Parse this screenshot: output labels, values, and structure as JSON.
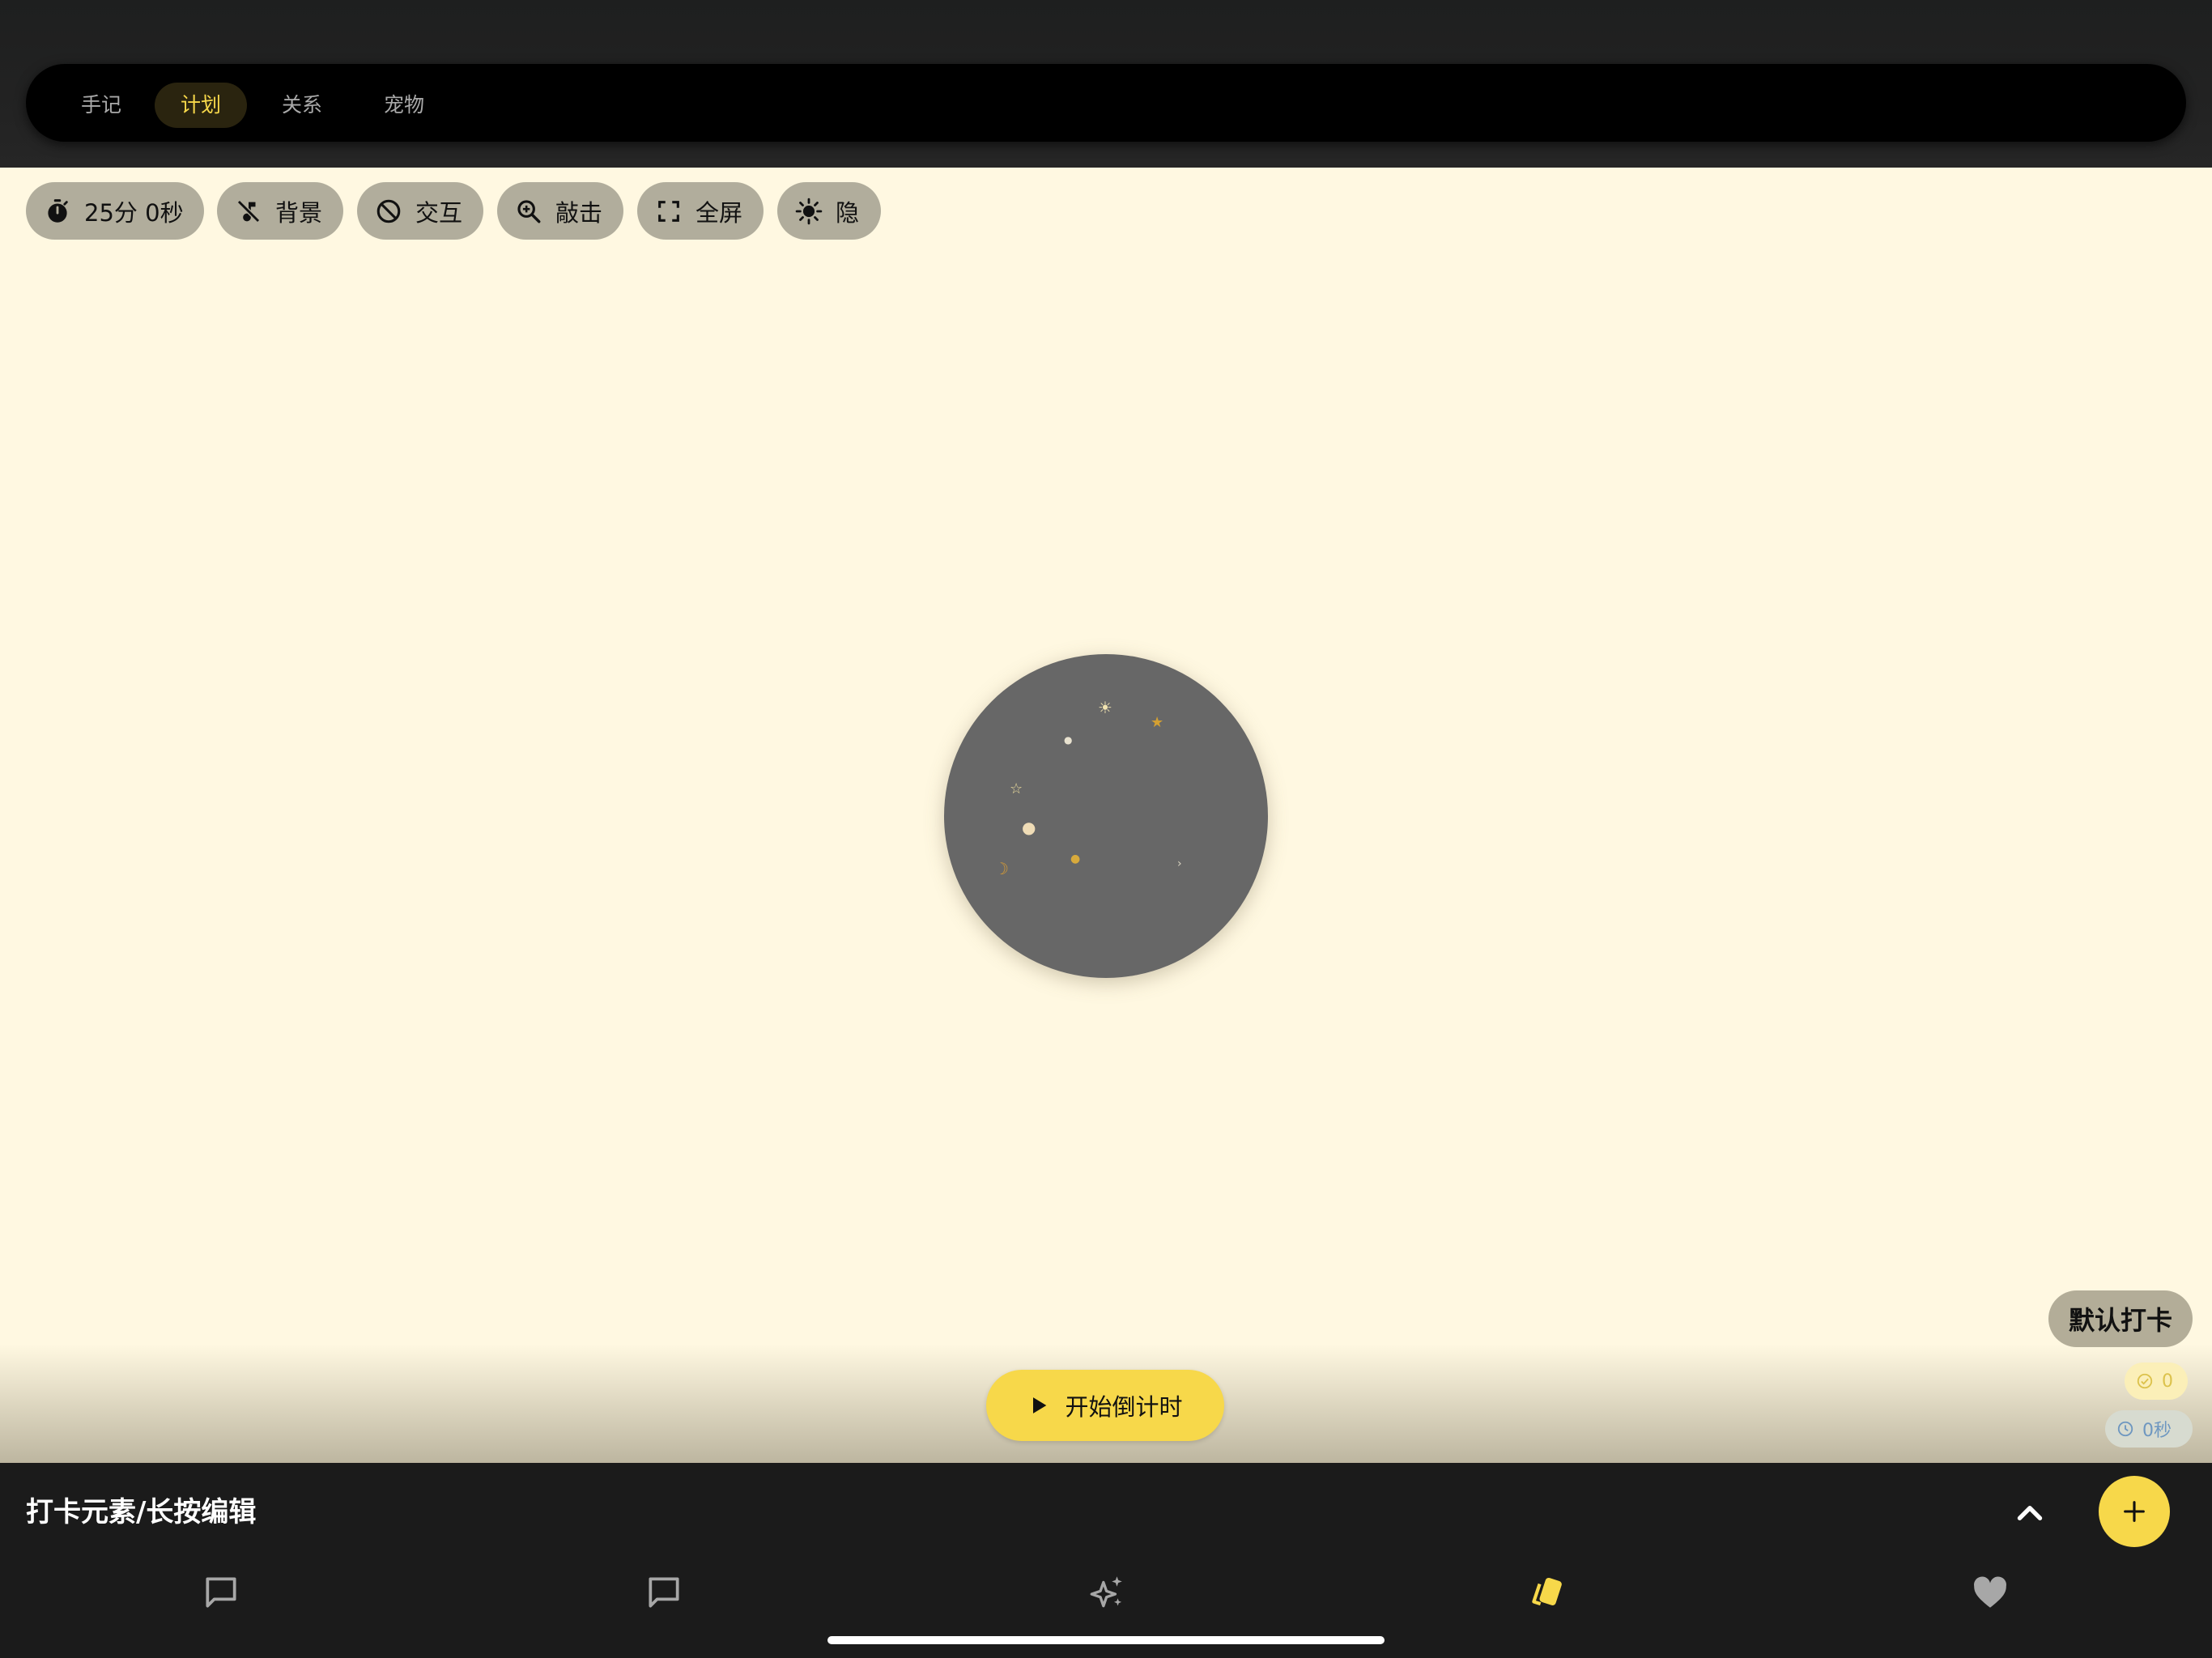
{
  "top_tabs": [
    {
      "label": "手记",
      "active": false
    },
    {
      "label": "计划",
      "active": true
    },
    {
      "label": "关系",
      "active": false
    },
    {
      "label": "宠物",
      "active": false
    }
  ],
  "toolbar": {
    "timer": {
      "label": "25分 0秒",
      "icon": "stopwatch-icon"
    },
    "background": {
      "label": "背景",
      "icon": "music-off-icon"
    },
    "interaction": {
      "label": "交互",
      "icon": "block-icon"
    },
    "tap": {
      "label": "敲击",
      "icon": "zoom-in-icon"
    },
    "fullscreen": {
      "label": "全屏",
      "icon": "fullscreen-icon"
    },
    "hide": {
      "label": "隐",
      "icon": "brightness-icon"
    }
  },
  "checkin": {
    "name": "默认打卡",
    "completed_count": "0",
    "duration": "0秒"
  },
  "start_button": {
    "label": "开始倒计时",
    "icon": "play-icon"
  },
  "bottom_panel": {
    "title": "打卡元素/长按编辑",
    "collapse_icon": "chevron-up-icon",
    "add_icon": "plus-icon"
  },
  "bottom_nav": [
    {
      "icon": "chat-bubble-icon",
      "active": false
    },
    {
      "icon": "comment-icon",
      "active": false
    },
    {
      "icon": "sparkle-icon",
      "active": false
    },
    {
      "icon": "cards-icon",
      "active": true
    },
    {
      "icon": "heart-icon",
      "active": false
    }
  ],
  "colors": {
    "accent": "#f7d84a",
    "background": "#fff8e1",
    "dark": "#1b1b1b",
    "chip": "#b1ad9c",
    "orb": "#676767"
  }
}
